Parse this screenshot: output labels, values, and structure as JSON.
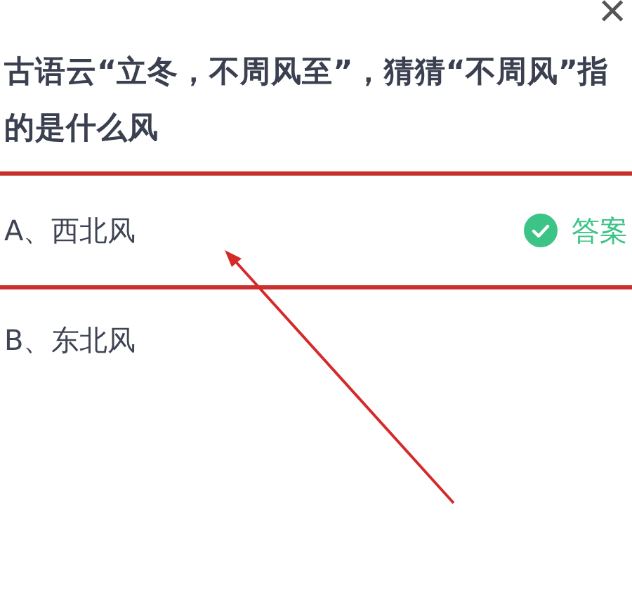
{
  "close_button": {
    "label": "×"
  },
  "question": "古语云“立冬，不周风至”，猜猜“不周风”指的是什么风",
  "options": [
    {
      "label": "A、西北风",
      "correct": true,
      "highlighted": true,
      "answer_label": "答案"
    },
    {
      "label": "B、东北风",
      "correct": false,
      "highlighted": false
    }
  ]
}
